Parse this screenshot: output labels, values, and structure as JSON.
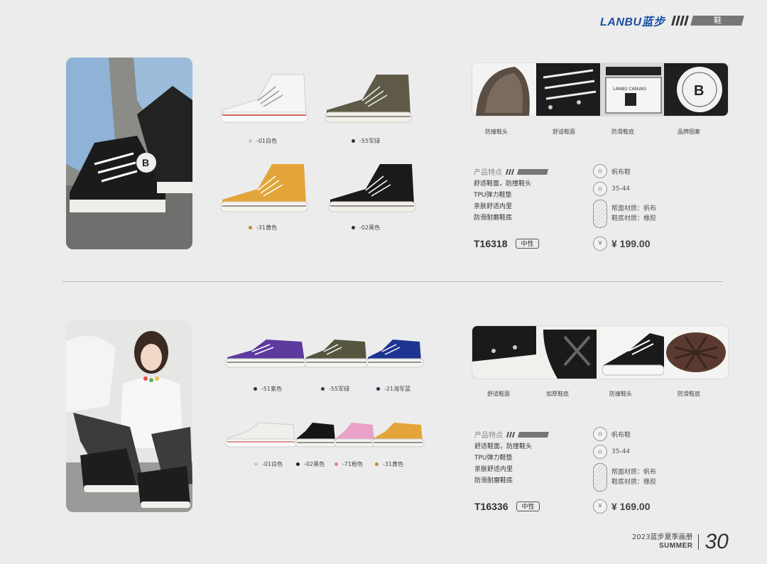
{
  "header": {
    "brand": "LANBU蓝步",
    "category": "鞋"
  },
  "products": [
    {
      "variants": [
        {
          "label": "-01白色",
          "dot": "#c9c9c9"
        },
        {
          "label": "-55军绿",
          "dot": "#333333"
        },
        {
          "label": "-31黄色",
          "dot": "#c48a3a"
        },
        {
          "label": "-02黑色",
          "dot": "#333333"
        }
      ],
      "strip_labels": [
        "防撞鞋头",
        "舒适鞋面",
        "防滑鞋底",
        "品牌图案"
      ],
      "features_title": "产品特点",
      "features": [
        "舒适鞋面，防撞鞋头",
        "TPU弹力鞋垫",
        "亲肤舒适内里",
        "防滑耐磨鞋底"
      ],
      "code": "T16318",
      "gender": "中性",
      "spec_type": "帆布鞋",
      "spec_size": "35-44",
      "spec_material_upper": "帮面材质：帆布",
      "spec_material_sole": "鞋底材质：橡胶",
      "price": "¥ 199.00"
    },
    {
      "variants": [
        {
          "label": "-51紫色",
          "dot": "#2a2f52"
        },
        {
          "label": "-55军绿",
          "dot": "#3b3b3b"
        },
        {
          "label": "-21海军蓝",
          "dot": "#1e2b5a"
        },
        {
          "label": "-01白色",
          "dot": "#c9c9c9"
        },
        {
          "label": "-02黑色",
          "dot": "#222222"
        },
        {
          "label": "-71粉色",
          "dot": "#d97bb0"
        },
        {
          "label": "-31黄色",
          "dot": "#c48a3a"
        }
      ],
      "strip_labels": [
        "舒适鞋面",
        "加厚鞋底",
        "防撞鞋头",
        "防滑鞋底"
      ],
      "features_title": "产品特点",
      "features": [
        "舒适鞋面，防撞鞋头",
        "TPU弹力鞋垫",
        "亲肤舒适内里",
        "防滑耐磨鞋底"
      ],
      "code": "T16336",
      "gender": "中性",
      "spec_type": "帆布鞋",
      "spec_size": "35-44",
      "spec_material_upper": "帮面材质：帆布",
      "spec_material_sole": "鞋底材质：橡胶",
      "price": "¥ 169.00"
    }
  ],
  "footer": {
    "catalog": "2023蓝步夏季画册",
    "season": "SUMMER",
    "page": "30"
  }
}
